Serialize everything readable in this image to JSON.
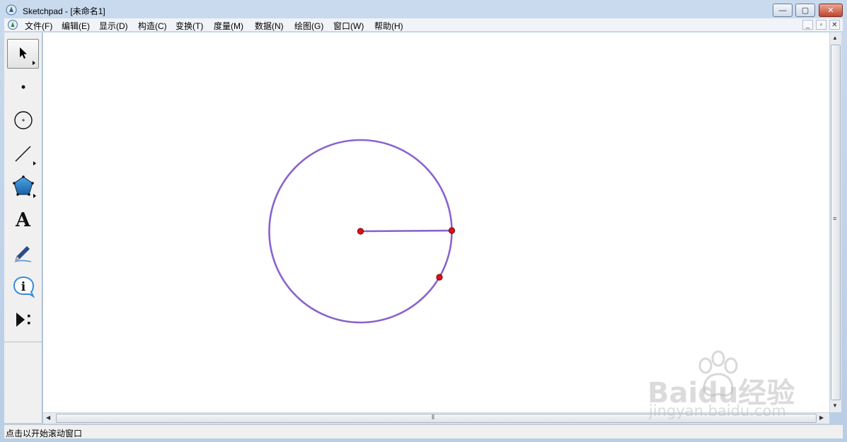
{
  "window": {
    "app_name": "Sketchpad",
    "document": " - [未命名1]",
    "controls": {
      "minimize": "—",
      "maximize": "▢",
      "close": "✕"
    }
  },
  "menubar": {
    "items": [
      "文件(F)",
      "编辑(E)",
      "显示(D)",
      "构造(C)",
      "变换(T)",
      "度量(M)",
      "数据(N)",
      "绘图(G)",
      "窗口(W)",
      "帮助(H)"
    ],
    "doc_controls": {
      "minimize": "_",
      "restore": "▫",
      "close": "✕"
    }
  },
  "toolbox": {
    "tools": [
      {
        "name": "arrow-tool",
        "icon": "pointer-arrow-icon",
        "selected": true
      },
      {
        "name": "point-tool",
        "icon": "point-icon"
      },
      {
        "name": "compass-tool",
        "icon": "circle-icon"
      },
      {
        "name": "straightedge-tool",
        "icon": "segment-icon"
      },
      {
        "name": "polygon-tool",
        "icon": "pentagon-icon"
      },
      {
        "name": "text-tool",
        "icon": "text-A-icon",
        "label": "A"
      },
      {
        "name": "marker-tool",
        "icon": "pen-icon"
      },
      {
        "name": "information-tool",
        "icon": "info-icon",
        "label": "i"
      },
      {
        "name": "custom-tool",
        "icon": "play-custom-icon"
      }
    ]
  },
  "sketch": {
    "circle_color": "#8a63cc",
    "point_color": "#e01010"
  },
  "status": {
    "text": "点击以开始滚动窗口"
  },
  "watermark": {
    "brand": "Baidu经验",
    "url": "jingyan.baidu.com"
  }
}
